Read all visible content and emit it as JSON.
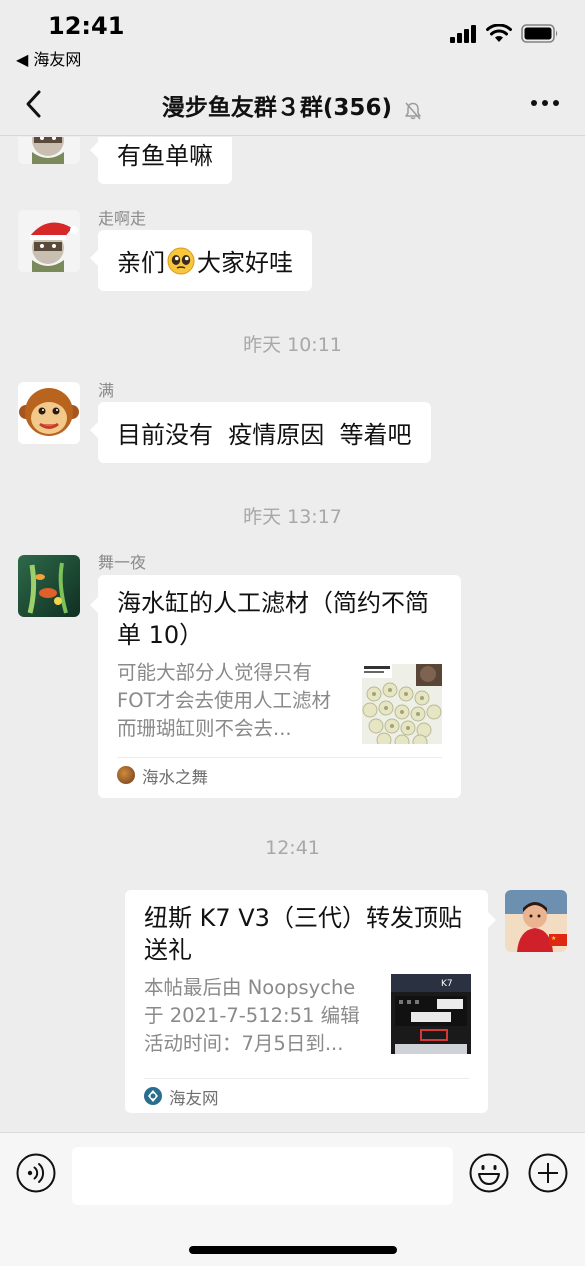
{
  "status_bar": {
    "time": "12:41",
    "back_app": "◀ 海友网"
  },
  "nav": {
    "title": "漫步鱼友群３群(356)"
  },
  "messages": [
    {
      "type": "text",
      "side": "left",
      "avatar": "santa-ninja-avatar",
      "text": "有鱼单嘛"
    },
    {
      "type": "text",
      "side": "left",
      "avatar": "santa-ninja-avatar",
      "sender": "走啊走",
      "text_before": "亲们",
      "emoji": "pleading-face-emoji",
      "text_after": "大家好哇"
    },
    {
      "type": "time",
      "text": "昨天 10:11"
    },
    {
      "type": "text",
      "side": "left",
      "avatar": "monkey-avatar",
      "sender": "满",
      "text": "目前没有  疫情原因  等着吧"
    },
    {
      "type": "time",
      "text": "昨天 13:17"
    },
    {
      "type": "link",
      "side": "left",
      "avatar": "fish-tank-avatar",
      "sender": "舞一夜",
      "title": "海水缸的人工滤材（简约不简单 10）",
      "description": "可能大部分人觉得只有FOT才会去使用人工滤材而珊瑚缸则不会去...",
      "thumbnail": "ceramic-rings-thumbnail",
      "source": "海水之舞"
    },
    {
      "type": "time",
      "text": "12:41"
    },
    {
      "type": "link",
      "side": "right",
      "avatar": "child-red-shirt-avatar",
      "title": "纽斯 K7 V3（三代）转发顶贴送礼",
      "description": "本帖最后由 Noopsyche 于 2021-7-512:51 编辑 活动时间：7月5日到...",
      "thumbnail": "device-photo-thumbnail",
      "source": "海友网"
    }
  ],
  "input": {
    "value": "",
    "placeholder": ""
  },
  "colors": {
    "background": "#ededed",
    "bubble": "#ffffff",
    "secondary_text": "#8a8a8a"
  }
}
